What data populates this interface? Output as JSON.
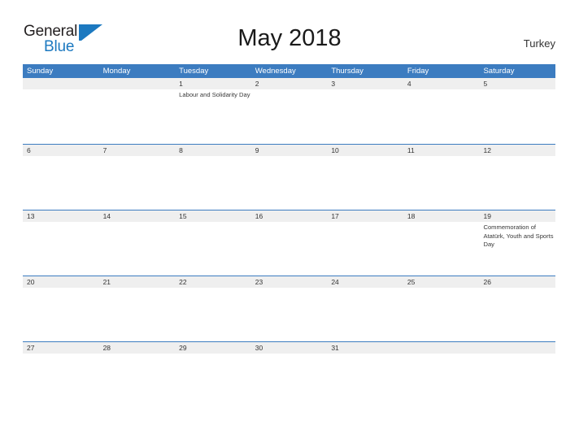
{
  "brand": {
    "name_part1": "General",
    "name_part2": "Blue",
    "logo_icon": "triangle-flag-icon"
  },
  "header": {
    "title": "May 2018",
    "region": "Turkey"
  },
  "colors": {
    "header_blue": "#3c7cc0",
    "brand_blue": "#1c79c0",
    "daynum_band": "#efefef",
    "text_dark": "#231f20"
  },
  "calendar": {
    "weekdays": [
      "Sunday",
      "Monday",
      "Tuesday",
      "Wednesday",
      "Thursday",
      "Friday",
      "Saturday"
    ],
    "weeks": [
      [
        {
          "date": "",
          "event": ""
        },
        {
          "date": "",
          "event": ""
        },
        {
          "date": "1",
          "event": "Labour and Solidarity Day"
        },
        {
          "date": "2",
          "event": ""
        },
        {
          "date": "3",
          "event": ""
        },
        {
          "date": "4",
          "event": ""
        },
        {
          "date": "5",
          "event": ""
        }
      ],
      [
        {
          "date": "6",
          "event": ""
        },
        {
          "date": "7",
          "event": ""
        },
        {
          "date": "8",
          "event": ""
        },
        {
          "date": "9",
          "event": ""
        },
        {
          "date": "10",
          "event": ""
        },
        {
          "date": "11",
          "event": ""
        },
        {
          "date": "12",
          "event": ""
        }
      ],
      [
        {
          "date": "13",
          "event": ""
        },
        {
          "date": "14",
          "event": ""
        },
        {
          "date": "15",
          "event": ""
        },
        {
          "date": "16",
          "event": ""
        },
        {
          "date": "17",
          "event": ""
        },
        {
          "date": "18",
          "event": ""
        },
        {
          "date": "19",
          "event": "Commemoration of Atatürk, Youth and Sports Day"
        }
      ],
      [
        {
          "date": "20",
          "event": ""
        },
        {
          "date": "21",
          "event": ""
        },
        {
          "date": "22",
          "event": ""
        },
        {
          "date": "23",
          "event": ""
        },
        {
          "date": "24",
          "event": ""
        },
        {
          "date": "25",
          "event": ""
        },
        {
          "date": "26",
          "event": ""
        }
      ],
      [
        {
          "date": "27",
          "event": ""
        },
        {
          "date": "28",
          "event": ""
        },
        {
          "date": "29",
          "event": ""
        },
        {
          "date": "30",
          "event": ""
        },
        {
          "date": "31",
          "event": ""
        },
        {
          "date": "",
          "event": ""
        },
        {
          "date": "",
          "event": ""
        }
      ]
    ]
  }
}
